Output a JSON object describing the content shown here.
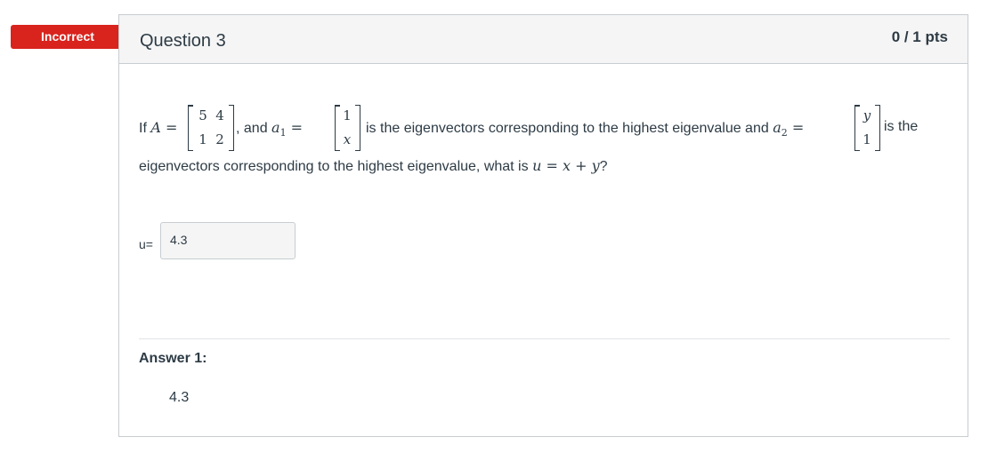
{
  "status_flag": "Incorrect",
  "question": {
    "title": "Question 3",
    "points": "0 / 1 pts",
    "text": {
      "if": "If ",
      "A": "A",
      "equals": " =",
      "and": ", and ",
      "a1": "a",
      "sub1": "1",
      "eq2": " =",
      "mid": "is the eigenvectors corresponding to the highest eigenvalue and ",
      "a2": "a",
      "sub2": "2",
      "eq3": " =",
      "is_the": "is the",
      "line2_a": "eigenvectors corresponding to the highest eigenvalue,  what is ",
      "u": "u",
      "line2_b": " = ",
      "x": "x",
      "plus": " + ",
      "y": "y",
      "q": "?"
    },
    "matrix_A": [
      "5",
      "4",
      "1",
      "2"
    ],
    "vector_a1": [
      "1",
      "x"
    ],
    "vector_a2": [
      "y",
      "1"
    ]
  },
  "input": {
    "label": "u=",
    "value": "4.3"
  },
  "answer": {
    "label": "Answer 1:",
    "value": "4.3"
  },
  "colors": {
    "incorrect_flag": "#d9231d",
    "header_bg": "#f5f5f5",
    "text": "#2d3b45",
    "border": "#c7cdd1"
  }
}
